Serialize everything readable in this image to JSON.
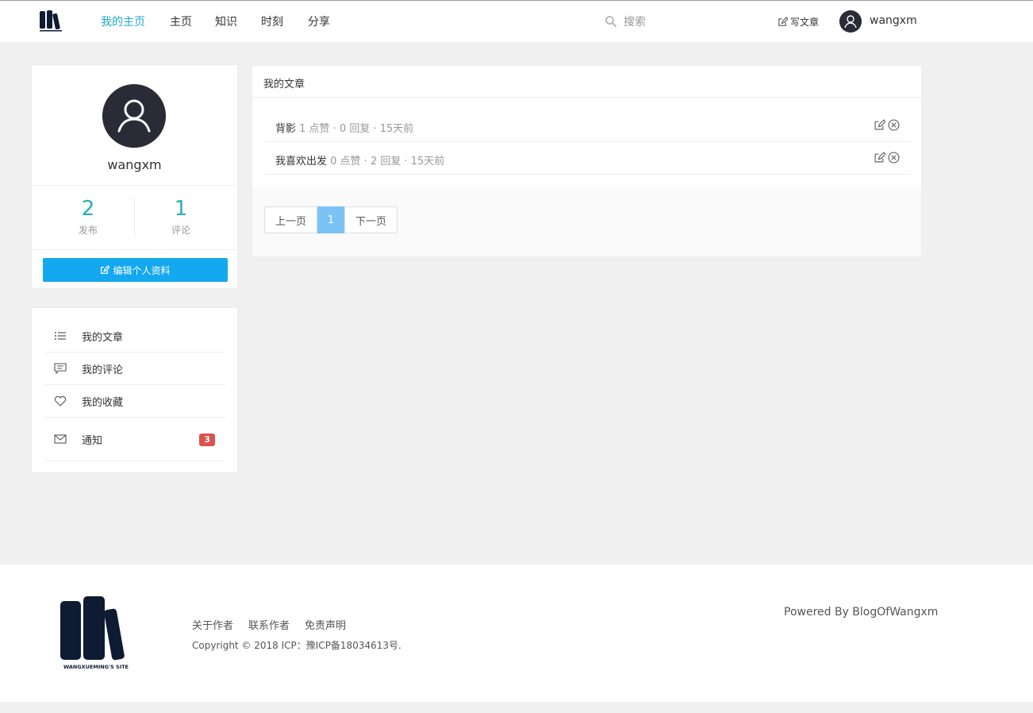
{
  "header": {
    "nav": [
      {
        "label": "我的主页",
        "active": true
      },
      {
        "label": "主页"
      },
      {
        "label": "知识"
      },
      {
        "label": "时刻"
      },
      {
        "label": "分享"
      }
    ],
    "search_placeholder": "搜索",
    "write_label": "写文章",
    "username": "wangxm"
  },
  "profile": {
    "name": "wangxm",
    "posts_count": "2",
    "posts_label": "发布",
    "comments_count": "1",
    "comments_label": "评论",
    "edit_label": "编辑个人资料"
  },
  "menu": {
    "items": [
      {
        "label": "我的文章",
        "icon": "list-icon"
      },
      {
        "label": "我的评论",
        "icon": "comment-icon"
      },
      {
        "label": "我的收藏",
        "icon": "heart-icon"
      },
      {
        "label": "通知",
        "icon": "mail-icon",
        "badge": "3"
      }
    ]
  },
  "articles": {
    "title": "我的文章",
    "items": [
      {
        "title": "背影",
        "meta": "1 点赞 · 0 回复 · 15天前"
      },
      {
        "title": "我喜欢出发",
        "meta": "0 点赞 · 2 回复 · 15天前"
      }
    ],
    "pager": {
      "prev": "上一页",
      "current": "1",
      "next": "下一页"
    }
  },
  "footer": {
    "links": [
      "关于作者",
      "联系作者",
      "免责声明"
    ],
    "copyright": "Copyright © 2018 ICP：豫ICP备18034613号.",
    "powered": "Powered By BlogOfWangxm",
    "logo_text": "WANGXUEMING'S SITE"
  },
  "colors": {
    "accent": "#1fa9c9",
    "stat": "#2bb0b0",
    "button": "#13a8ef",
    "badge": "#d9534f",
    "logo": "#0f1b33"
  }
}
